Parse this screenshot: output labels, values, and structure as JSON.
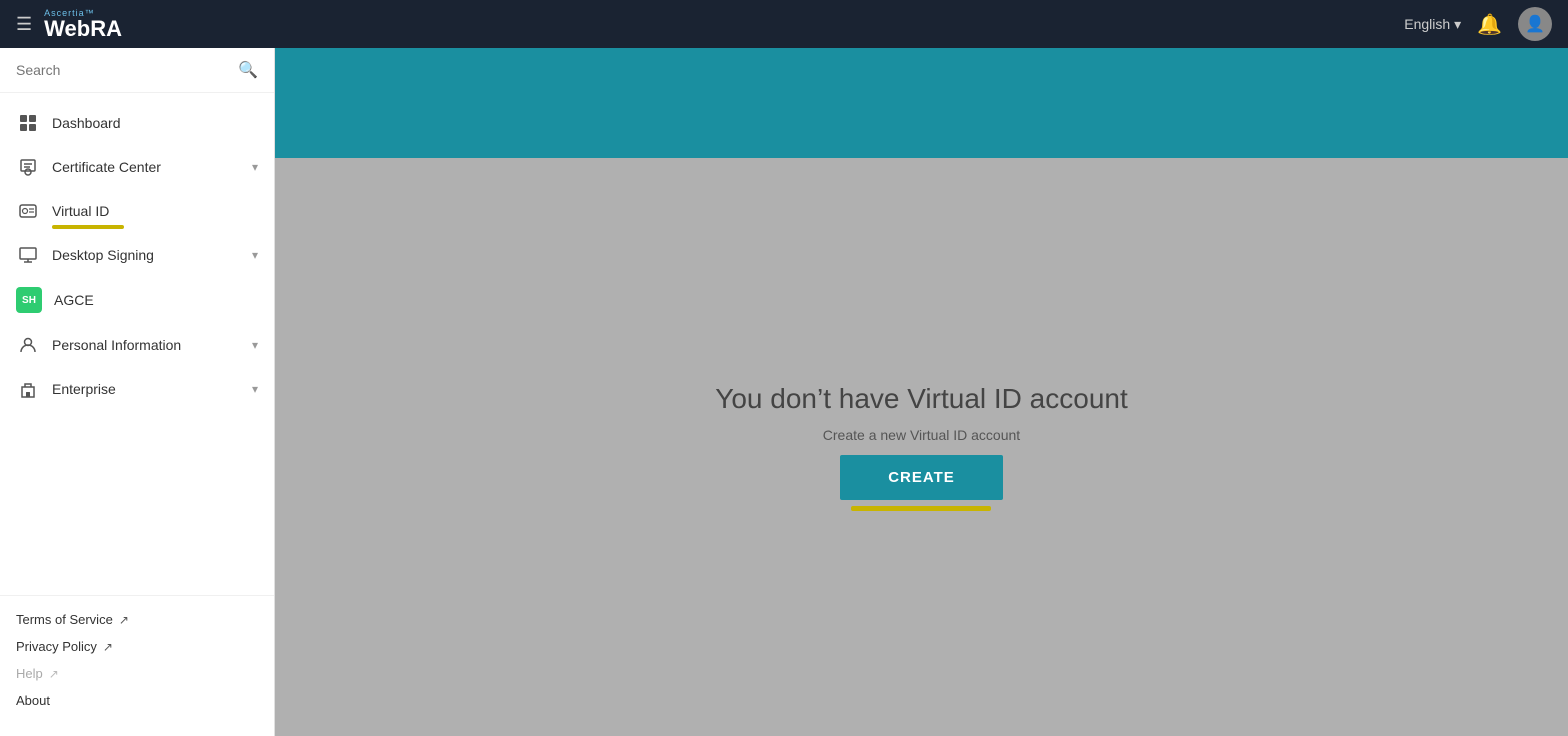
{
  "navbar": {
    "brand_top": "Ascertia™",
    "brand_main_prefix": "Web",
    "brand_main_bold": "RA",
    "lang": "English",
    "lang_arrow": "▾",
    "hamburger": "☰"
  },
  "sidebar": {
    "search_placeholder": "Search",
    "nav_items": [
      {
        "id": "dashboard",
        "label": "Dashboard",
        "icon": "dashboard",
        "has_chevron": false
      },
      {
        "id": "certificate-center",
        "label": "Certificate Center",
        "icon": "cert",
        "has_chevron": true
      },
      {
        "id": "virtual-id",
        "label": "Virtual ID",
        "icon": "virtualid",
        "has_chevron": false,
        "active": true
      },
      {
        "id": "desktop-signing",
        "label": "Desktop Signing",
        "icon": "desktop",
        "has_chevron": true
      },
      {
        "id": "agce",
        "label": "AGCE",
        "icon": "agce",
        "has_chevron": false
      },
      {
        "id": "personal-information",
        "label": "Personal Information",
        "icon": "person",
        "has_chevron": true
      },
      {
        "id": "enterprise",
        "label": "Enterprise",
        "icon": "enterprise",
        "has_chevron": true
      }
    ],
    "footer_links": [
      {
        "id": "terms",
        "label": "Terms of Service",
        "external": true,
        "dimmed": false
      },
      {
        "id": "privacy",
        "label": "Privacy Policy",
        "external": true,
        "dimmed": false
      },
      {
        "id": "help",
        "label": "Help",
        "external": true,
        "dimmed": true
      },
      {
        "id": "about",
        "label": "About",
        "external": false,
        "dimmed": false
      }
    ]
  },
  "main": {
    "no_account_title": "You don’t have Virtual ID account",
    "no_account_sub": "Create a new Virtual ID account",
    "create_btn_label": "CREATE"
  }
}
